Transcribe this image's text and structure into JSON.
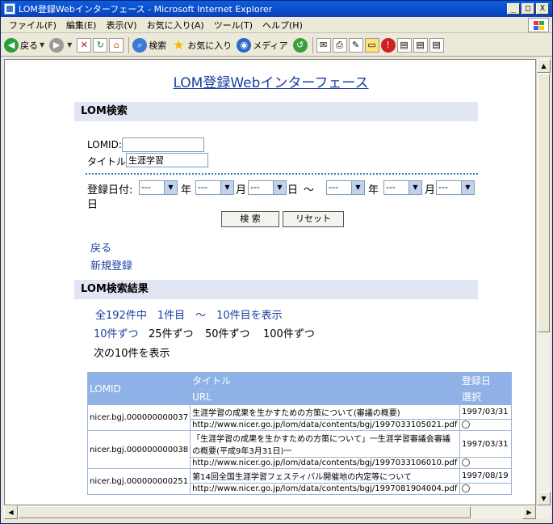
{
  "window": {
    "title": "LOM登録Webインターフェース - Microsoft Internet Explorer",
    "minimize": "_",
    "maximize": "□",
    "close": "X"
  },
  "menubar": [
    "ファイル(F)",
    "編集(E)",
    "表示(V)",
    "お気に入り(A)",
    "ツール(T)",
    "ヘルプ(H)"
  ],
  "toolbar": {
    "back": "戻る",
    "search": "検索",
    "favorites": "お気に入り",
    "media": "メディア"
  },
  "page": {
    "title": "LOM登録Webインターフェース",
    "search_section": "LOM検索",
    "lomid_label": "LOMID:",
    "lomid_value": "",
    "title_label": "タイトル:",
    "title_value": "生涯学習",
    "date_label": "登録日付:",
    "date_empty": "---",
    "year": "年",
    "month": "月",
    "day": "日",
    "tilde": "～",
    "search_button": "検 索",
    "reset_button": "リセット",
    "back_link": "戻る",
    "new_link": "新規登録",
    "results_section": "LOM検索結果",
    "summary": "全192件中　1件目　～　10件目を表示",
    "per10": "10件ずつ",
    "per25": "25件ずつ",
    "per50": "50件ずつ",
    "per100": "100件ずつ",
    "next10": "次の10件を表示"
  },
  "table": {
    "headers": {
      "lomid": "LOMID",
      "title": "タイトル",
      "url": "URL",
      "date": "登録日",
      "select": "選択"
    },
    "rows": [
      {
        "lomid": "nicer.bgj.000000000037",
        "title": "生涯学習の成果を生かすための方策について(審議の概要)",
        "url": "http://www.nicer.go.jp/lom/data/contents/bgj/1997033105021.pdf",
        "date": "1997/03/31"
      },
      {
        "lomid": "nicer.bgj.000000000038",
        "title": "「生涯学習の成果を生かすための方策について」一生涯学習審議会審議の概要(平成9年3月31日)一",
        "url": "http://www.nicer.go.jp/lom/data/contents/bgj/1997033106010.pdf",
        "date": "1997/03/31"
      },
      {
        "lomid": "nicer.bgj.000000000251",
        "title": "第14回全国生涯学習フェスティバル開催地の内定等について",
        "url": "http://www.nicer.go.jp/lom/data/contents/bgj/1997081904004.pdf",
        "date": "1997/08/19"
      }
    ]
  }
}
